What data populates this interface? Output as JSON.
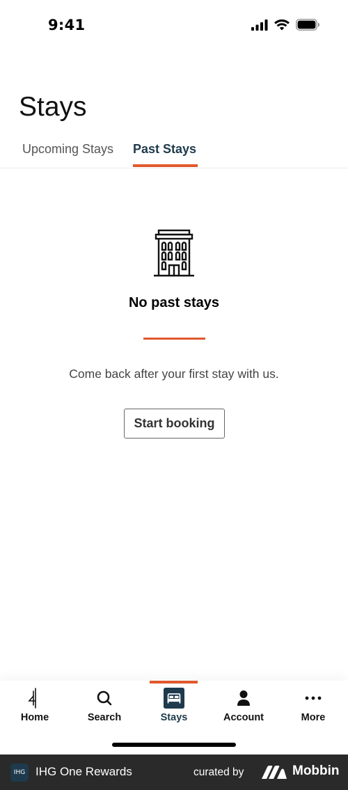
{
  "status_bar": {
    "time": "9:41"
  },
  "header": {
    "title": "Stays"
  },
  "tabs": [
    {
      "label": "Upcoming Stays",
      "active": false
    },
    {
      "label": "Past Stays",
      "active": true
    }
  ],
  "empty_state": {
    "icon": "hotel-building-icon",
    "title": "No past stays",
    "message": "Come back after your first stay with us.",
    "button_label": "Start booking"
  },
  "bottom_nav": {
    "items": [
      {
        "label": "Home",
        "icon": "ihg-logo-icon",
        "active": false
      },
      {
        "label": "Search",
        "icon": "search-icon",
        "active": false
      },
      {
        "label": "Stays",
        "icon": "bed-icon",
        "active": true
      },
      {
        "label": "Account",
        "icon": "person-icon",
        "active": false
      },
      {
        "label": "More",
        "icon": "more-dots-icon",
        "active": false
      }
    ]
  },
  "footer": {
    "badge": "IHG",
    "app_name": "IHG One Rewards",
    "curated_by": "curated by",
    "brand": "Mobbin"
  },
  "colors": {
    "accent": "#e0592d",
    "brand_navy": "#1e3a4c",
    "footer_bg": "#2a2a2a"
  }
}
